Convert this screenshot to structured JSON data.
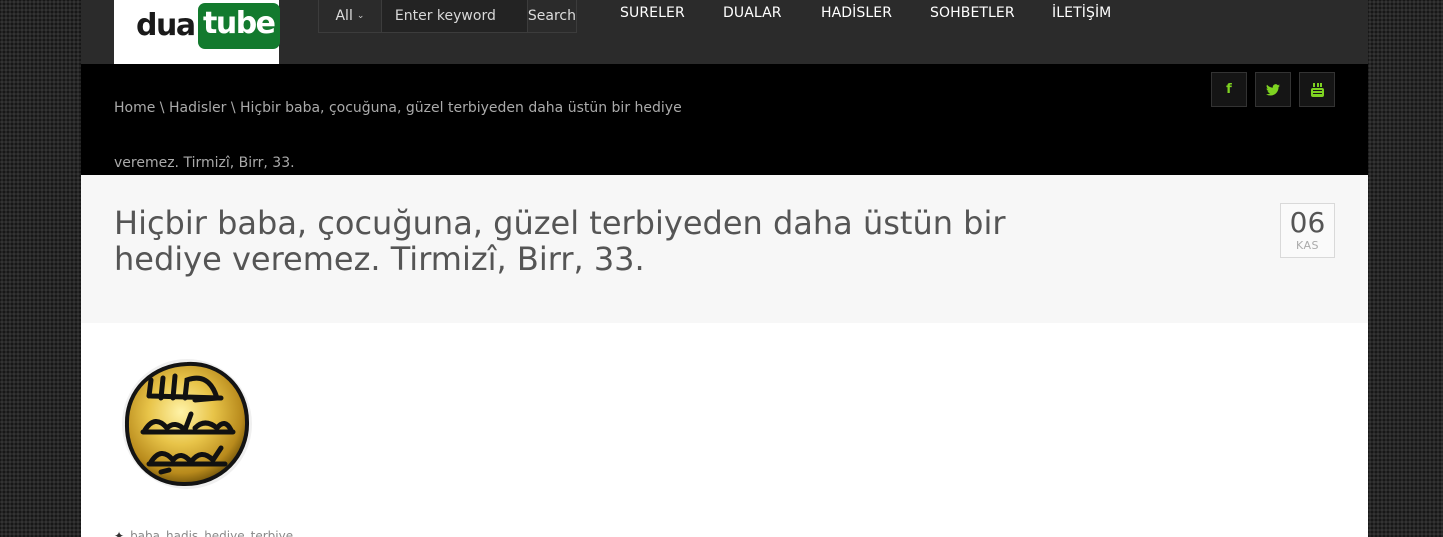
{
  "header": {
    "logo": {
      "part1": "dua",
      "part2": "tube"
    },
    "search": {
      "category": "All",
      "placeholder": "Enter keyword",
      "button": "Search"
    },
    "nav": [
      {
        "label": "SURELER"
      },
      {
        "label": "DUALAR"
      },
      {
        "label": "HADİSLER"
      },
      {
        "label": "SOHBETLER"
      },
      {
        "label": "İLETİŞİM"
      }
    ]
  },
  "breadcrumb": {
    "home": "Home",
    "separator": " \\ ",
    "section": "Hadisler",
    "current": "Hiçbir baba, çocuğuna, güzel terbiyeden daha üstün bir hediye veremez. Tirmizî, Birr, 33."
  },
  "social": {
    "icons": [
      "facebook-icon",
      "twitter-icon",
      "youtube-icon"
    ]
  },
  "post": {
    "title": "Hiçbir baba, çocuğuna, güzel terbiyeden daha üstün bir hediye veremez. Tirmizî, Birr, 33.",
    "date": {
      "day": "06",
      "month": "KAS"
    },
    "image_alt": "seal-image",
    "tags": [
      "baba",
      "hadis",
      "hediye",
      "terbiye"
    ]
  },
  "colors": {
    "accent_green": "#7ed321",
    "logo_green": "#137a2e"
  }
}
